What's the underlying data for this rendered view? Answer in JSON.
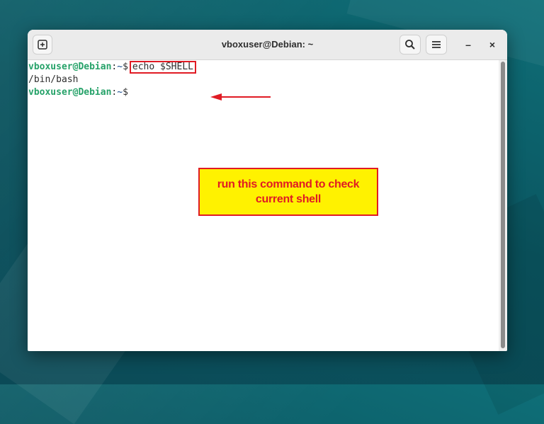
{
  "window": {
    "title": "vboxuser@Debian: ~",
    "minimize_glyph": "–",
    "close_glyph": "×"
  },
  "icons": {
    "new_tab": "new-tab-icon",
    "search": "search-icon",
    "menu": "hamburger-menu-icon"
  },
  "terminal": {
    "lines": [
      {
        "user_host": "vboxuser@Debian",
        "sep": ":",
        "path": "~",
        "prompt": "$",
        "command": "echo $SHELL"
      },
      {
        "output": "/bin/bash"
      },
      {
        "user_host": "vboxuser@Debian",
        "sep": ":",
        "path": "~",
        "prompt": "$"
      }
    ]
  },
  "annotation": {
    "text": "run this command to check current shell",
    "color": "#e01b24",
    "background": "#fff200"
  },
  "colors": {
    "prompt_user": "#26a269",
    "prompt_path": "#12488b"
  }
}
